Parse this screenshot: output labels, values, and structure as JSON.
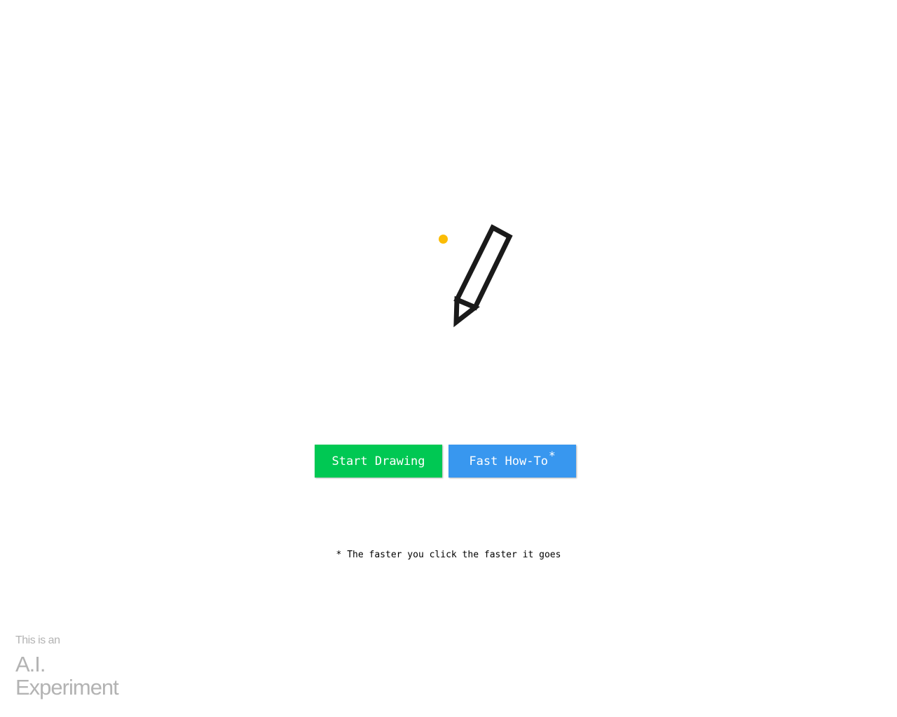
{
  "buttons": {
    "start_label": "Start Drawing",
    "howto_label": "Fast How-To",
    "howto_asterisk": "*"
  },
  "footnote": "* The faster you click the faster it goes",
  "badge": {
    "line1": "This is an",
    "line2": "A.I.",
    "line3": "Experiment"
  },
  "illustration": {
    "icon": "pencil-icon",
    "dot_icon": "dot-icon"
  },
  "colors": {
    "start_button": "#00c853",
    "howto_button": "#3897ef",
    "dot": "#fbbc05",
    "pencil_stroke": "#1a1a1a",
    "badge_text": "#b3b3b3"
  }
}
